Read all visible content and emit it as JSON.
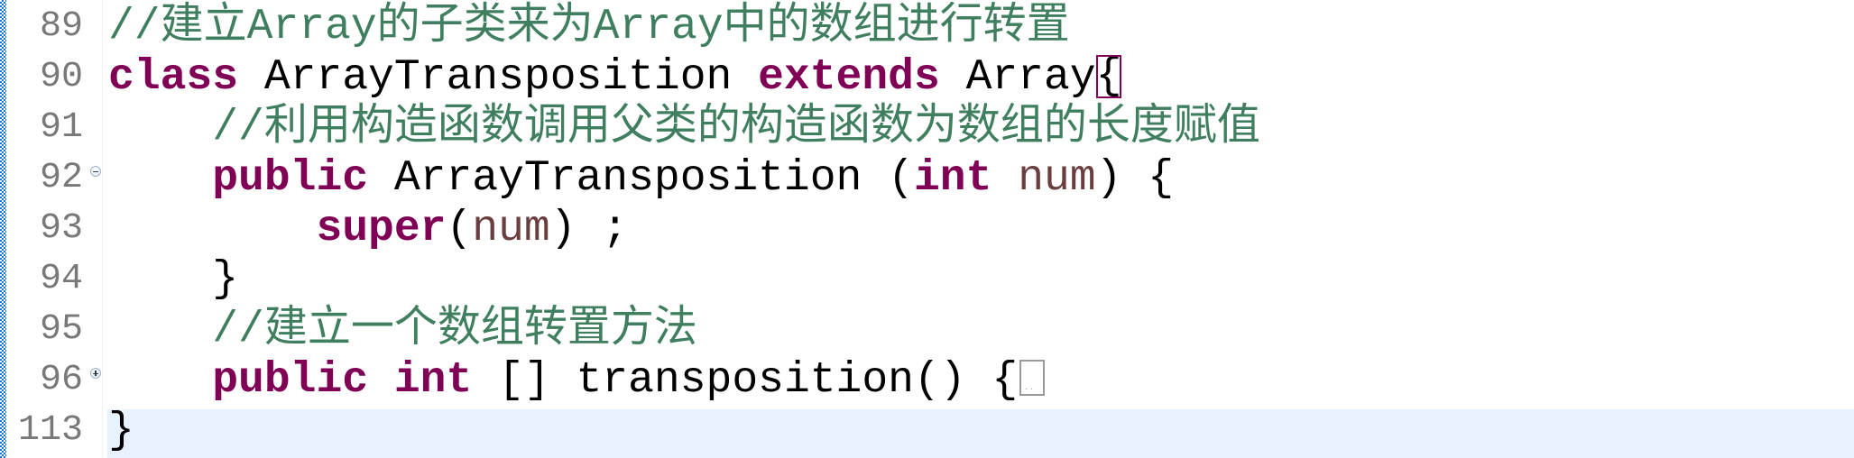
{
  "editor": {
    "language": "java",
    "colors": {
      "keyword": "#7F0055",
      "comment": "#3F7F5F",
      "local_variable": "#6A3E3E",
      "line_number": "#787878",
      "current_line_highlight": "#E8F2FE",
      "bracket_match_border": "#7F0055"
    },
    "current_line": "113",
    "lines": [
      {
        "number": "89",
        "fold": null,
        "indent": "",
        "tokens": [
          {
            "type": "comment",
            "text": "//建立Array的子类来为Array中的数组进行转置"
          }
        ]
      },
      {
        "number": "90",
        "fold": null,
        "indent": "",
        "tokens": [
          {
            "type": "keyword",
            "text": "class"
          },
          {
            "type": "plain",
            "text": " ArrayTransposition "
          },
          {
            "type": "keyword",
            "text": "extends"
          },
          {
            "type": "plain",
            "text": " Array"
          },
          {
            "type": "bracket-match",
            "text": "{"
          }
        ]
      },
      {
        "number": "91",
        "fold": null,
        "indent": "    ",
        "tokens": [
          {
            "type": "comment",
            "text": "//利用构造函数调用父类的构造函数为数组的长度赋值"
          }
        ]
      },
      {
        "number": "92",
        "fold": "collapse-icon",
        "indent": "    ",
        "tokens": [
          {
            "type": "keyword",
            "text": "public"
          },
          {
            "type": "plain",
            "text": " ArrayTransposition ("
          },
          {
            "type": "keyword",
            "text": "int"
          },
          {
            "type": "plain",
            "text": " "
          },
          {
            "type": "variable",
            "text": "num"
          },
          {
            "type": "plain",
            "text": ") {"
          }
        ]
      },
      {
        "number": "93",
        "fold": null,
        "indent": "        ",
        "tokens": [
          {
            "type": "keyword",
            "text": "super"
          },
          {
            "type": "plain",
            "text": "("
          },
          {
            "type": "variable",
            "text": "num"
          },
          {
            "type": "plain",
            "text": ") ;"
          }
        ]
      },
      {
        "number": "94",
        "fold": null,
        "indent": "    ",
        "tokens": [
          {
            "type": "plain",
            "text": "}"
          }
        ]
      },
      {
        "number": "95",
        "fold": null,
        "indent": "    ",
        "tokens": [
          {
            "type": "comment",
            "text": "//建立一个数组转置方法"
          }
        ]
      },
      {
        "number": "96",
        "fold": "expand-icon",
        "indent": "    ",
        "tokens": [
          {
            "type": "keyword",
            "text": "public"
          },
          {
            "type": "plain",
            "text": " "
          },
          {
            "type": "keyword",
            "text": "int"
          },
          {
            "type": "plain",
            "text": " [] transposition() {"
          },
          {
            "type": "folded-placeholder",
            "text": ""
          }
        ]
      },
      {
        "number": "113",
        "fold": null,
        "indent": "",
        "tokens": [
          {
            "type": "plain",
            "text": "}"
          }
        ]
      }
    ]
  }
}
